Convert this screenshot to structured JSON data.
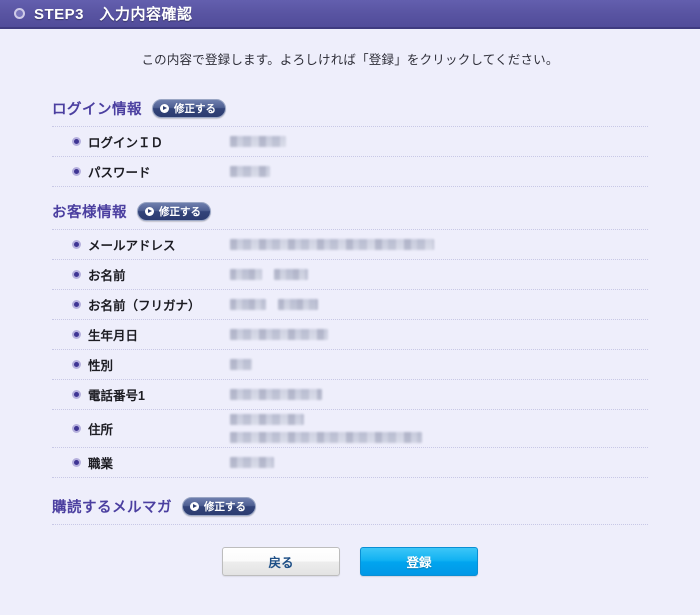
{
  "header": {
    "icon": "ring-icon",
    "step_label": "STEP3",
    "title": "入力内容確認",
    "full_title": "STEP3　入力内容確認",
    "bg_color": "#5954a2"
  },
  "intro": {
    "text": "この内容で登録します。よろしければ「登録」をクリックしてください。"
  },
  "edit_button_label": "修正する",
  "sections": [
    {
      "id": "login-info",
      "title": "ログイン情報",
      "edit_label": "修正する",
      "rows": [
        {
          "label": "ログインＩＤ",
          "value": "",
          "redacted": true,
          "lines": 1,
          "widths": [
            56
          ]
        },
        {
          "label": "パスワード",
          "value": "",
          "redacted": true,
          "lines": 1,
          "widths": [
            40
          ]
        }
      ]
    },
    {
      "id": "customer-info",
      "title": "お客様情報",
      "edit_label": "修正する",
      "rows": [
        {
          "label": "メールアドレス",
          "value": "",
          "redacted": true,
          "lines": 1,
          "widths": [
            204
          ]
        },
        {
          "label": "お名前",
          "value": "",
          "redacted": true,
          "lines": 1,
          "segments": [
            32,
            34
          ]
        },
        {
          "label": "お名前（フリガナ）",
          "value": "",
          "redacted": true,
          "lines": 1,
          "segments": [
            36,
            40
          ]
        },
        {
          "label": "生年月日",
          "value": "",
          "redacted": true,
          "lines": 1,
          "widths": [
            98
          ]
        },
        {
          "label": "性別",
          "value": "",
          "redacted": true,
          "lines": 1,
          "widths": [
            22
          ]
        },
        {
          "label": "電話番号1",
          "value": "",
          "redacted": true,
          "lines": 1,
          "widths": [
            92
          ]
        },
        {
          "label": "住所",
          "value": "",
          "redacted": true,
          "lines": 2,
          "widths": [
            74,
            192
          ]
        },
        {
          "label": "職業",
          "value": "",
          "redacted": true,
          "lines": 1,
          "widths": [
            44
          ]
        }
      ]
    },
    {
      "id": "newsletter",
      "title": "購読するメルマガ",
      "edit_label": "修正する",
      "rows": []
    }
  ],
  "footer": {
    "back_label": "戻る",
    "submit_label": "登録",
    "submit_color": "#01a5ef"
  }
}
